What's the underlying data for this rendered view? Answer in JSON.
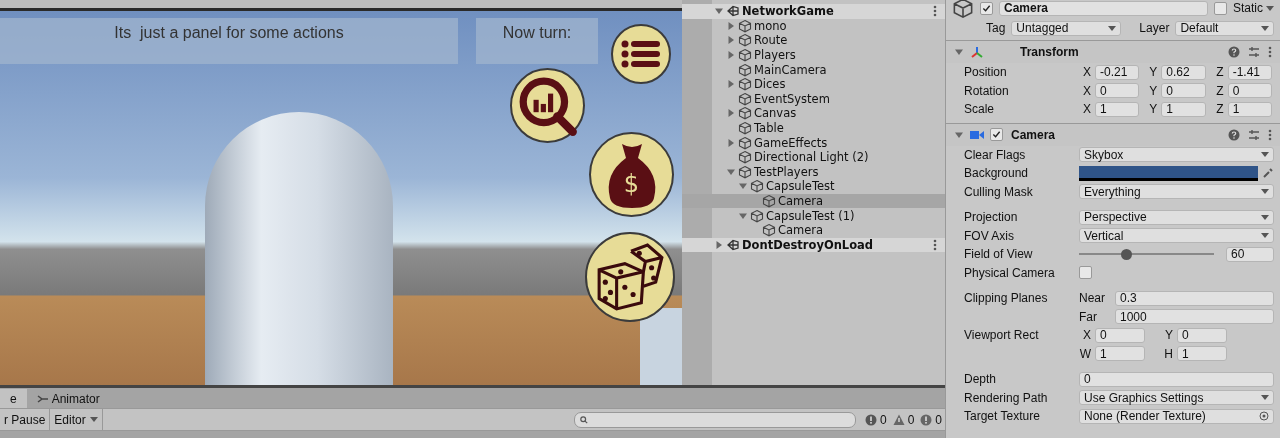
{
  "game_view": {
    "panel_text": "Its  just a panel for some actions",
    "turn_label": "Now turn:",
    "money_symbol": "$"
  },
  "hierarchy": {
    "items": [
      {
        "label": "NetworkGame",
        "kind": "scene",
        "expanded": true,
        "selected": false,
        "children": [
          {
            "label": "mono",
            "kind": "object",
            "expanded": false,
            "selected": false
          },
          {
            "label": "Route",
            "kind": "object",
            "expanded": false,
            "selected": false
          },
          {
            "label": "Players",
            "kind": "object",
            "expanded": false,
            "selected": false
          },
          {
            "label": "MainCamera",
            "kind": "object",
            "selected": false
          },
          {
            "label": "Dices",
            "kind": "object",
            "expanded": false,
            "selected": false
          },
          {
            "label": "EventSystem",
            "kind": "object",
            "selected": false
          },
          {
            "label": "Canvas",
            "kind": "object",
            "expanded": false,
            "selected": false
          },
          {
            "label": "Table",
            "kind": "object",
            "selected": false
          },
          {
            "label": "GameEffects",
            "kind": "object",
            "expanded": false,
            "selected": false
          },
          {
            "label": "Directional Light (2)",
            "kind": "object",
            "selected": false
          },
          {
            "label": "TestPlayers",
            "kind": "object",
            "expanded": true,
            "selected": false,
            "children": [
              {
                "label": "CapsuleTest",
                "kind": "object",
                "expanded": true,
                "selected": false,
                "children": [
                  {
                    "label": "Camera",
                    "kind": "object",
                    "selected": true
                  }
                ]
              },
              {
                "label": "CapsuleTest (1)",
                "kind": "object",
                "expanded": true,
                "selected": false,
                "children": [
                  {
                    "label": "Camera",
                    "kind": "object",
                    "selected": false
                  }
                ]
              }
            ]
          }
        ]
      },
      {
        "label": "DontDestroyOnLoad",
        "kind": "scene",
        "expanded": false,
        "selected": false
      }
    ]
  },
  "inspector": {
    "name": "Camera",
    "active": true,
    "static_label": "Static",
    "static": false,
    "tag_label": "Tag",
    "tag": "Untagged",
    "layer_label": "Layer",
    "layer": "Default",
    "transform": {
      "title": "Transform",
      "expanded": true,
      "rows": [
        {
          "label": "Position",
          "axes": [
            {
              "label": "X",
              "value": "-0.21"
            },
            {
              "label": "Y",
              "value": "0.62"
            },
            {
              "label": "Z",
              "value": "-1.41"
            }
          ]
        },
        {
          "label": "Rotation",
          "axes": [
            {
              "label": "X",
              "value": "0"
            },
            {
              "label": "Y",
              "value": "0"
            },
            {
              "label": "Z",
              "value": "0"
            }
          ]
        },
        {
          "label": "Scale",
          "axes": [
            {
              "label": "X",
              "value": "1"
            },
            {
              "label": "Y",
              "value": "1"
            },
            {
              "label": "Z",
              "value": "1"
            }
          ]
        }
      ]
    },
    "camera": {
      "title": "Camera",
      "expanded": true,
      "enabled": true,
      "properties": [
        {
          "kind": "dropdown",
          "label": "Clear Flags",
          "value": "Skybox"
        },
        {
          "kind": "color",
          "label": "Background",
          "color": "#2f5488"
        },
        {
          "kind": "dropdown",
          "label": "Culling Mask",
          "value": "Everything"
        },
        {
          "kind": "gap"
        },
        {
          "kind": "dropdown",
          "label": "Projection",
          "value": "Perspective"
        },
        {
          "kind": "dropdown",
          "label": "FOV Axis",
          "value": "Vertical"
        },
        {
          "kind": "slider",
          "label": "Field of View",
          "level": 0.35,
          "value": "60"
        },
        {
          "kind": "checkbox",
          "label": "Physical Camera",
          "checked": false
        },
        {
          "kind": "gap"
        },
        {
          "kind": "pair",
          "label": "Clipping Planes",
          "fields": [
            {
              "label": "Near",
              "value": "0.3"
            },
            {
              "label": "Far",
              "value": "1000"
            }
          ]
        },
        {
          "kind": "rect",
          "label": "Viewport Rect",
          "fields": [
            {
              "label": "X",
              "value": "0"
            },
            {
              "label": "Y",
              "value": "0"
            },
            {
              "label": "W",
              "value": "1"
            },
            {
              "label": "H",
              "value": "1"
            }
          ]
        },
        {
          "kind": "gap"
        },
        {
          "kind": "text",
          "label": "Depth",
          "value": "0"
        },
        {
          "kind": "dropdown",
          "label": "Rendering Path",
          "value": "Use Graphics Settings"
        },
        {
          "kind": "object",
          "label": "Target Texture",
          "value": "None (Render Texture)"
        }
      ]
    }
  },
  "bottom": {
    "tabs": [
      {
        "label": "e",
        "selected": true
      },
      {
        "label": "Animator",
        "selected": false
      }
    ],
    "pause_button": "r Pause",
    "editor_dropdown": "Editor",
    "counts": [
      {
        "kind": "info",
        "value": "0"
      },
      {
        "kind": "warning",
        "value": "0"
      },
      {
        "kind": "error",
        "value": "0"
      }
    ]
  }
}
